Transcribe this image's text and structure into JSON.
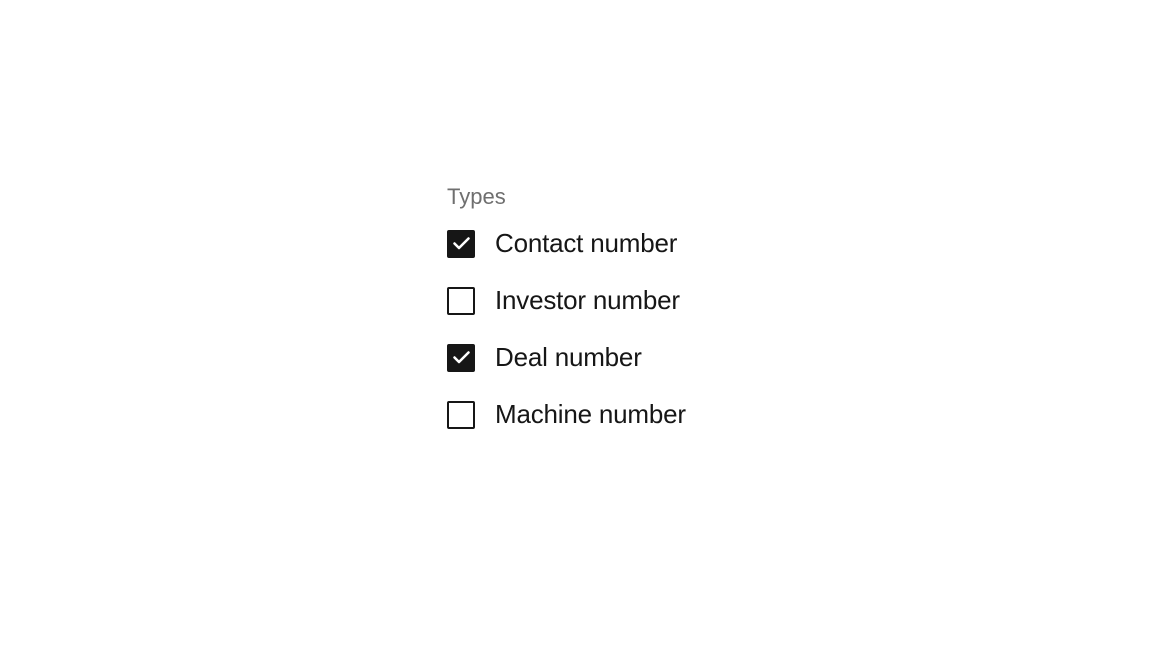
{
  "group": {
    "legend": "Types",
    "items": [
      {
        "label": "Contact number",
        "checked": true
      },
      {
        "label": "Investor number",
        "checked": false
      },
      {
        "label": "Deal number",
        "checked": true
      },
      {
        "label": "Machine number",
        "checked": false
      }
    ]
  }
}
